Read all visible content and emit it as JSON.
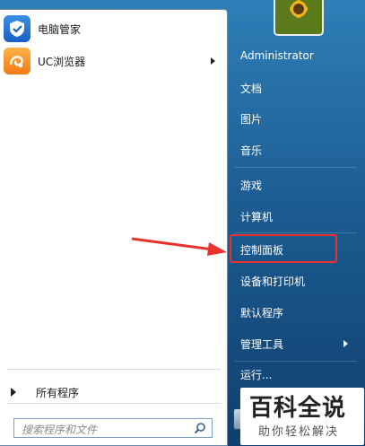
{
  "pinned_programs": [
    {
      "label": "电脑管家",
      "icon": "tencent-pc-manager-icon",
      "has_submenu": false
    },
    {
      "label": "UC浏览器",
      "icon": "uc-browser-icon",
      "has_submenu": true
    }
  ],
  "all_programs_label": "所有程序",
  "search": {
    "placeholder": "搜索程序和文件"
  },
  "user": {
    "name": "Administrator",
    "picture": "sunflower-avatar"
  },
  "right_items": [
    {
      "label": "文档",
      "has_submenu": false
    },
    {
      "label": "图片",
      "has_submenu": false
    },
    {
      "label": "音乐",
      "has_submenu": false
    },
    {
      "label": "游戏",
      "has_submenu": false
    },
    {
      "label": "计算机",
      "has_submenu": false
    },
    {
      "label": "控制面板",
      "has_submenu": false,
      "highlighted": true
    },
    {
      "label": "设备和打印机",
      "has_submenu": false
    },
    {
      "label": "默认程序",
      "has_submenu": false
    },
    {
      "label": "管理工具",
      "has_submenu": true
    },
    {
      "label": "运行...",
      "has_submenu": false
    }
  ],
  "annotation": {
    "color": "#e8322d"
  },
  "watermark": {
    "title": "百科全说",
    "subtitle": "助你轻松解决"
  }
}
